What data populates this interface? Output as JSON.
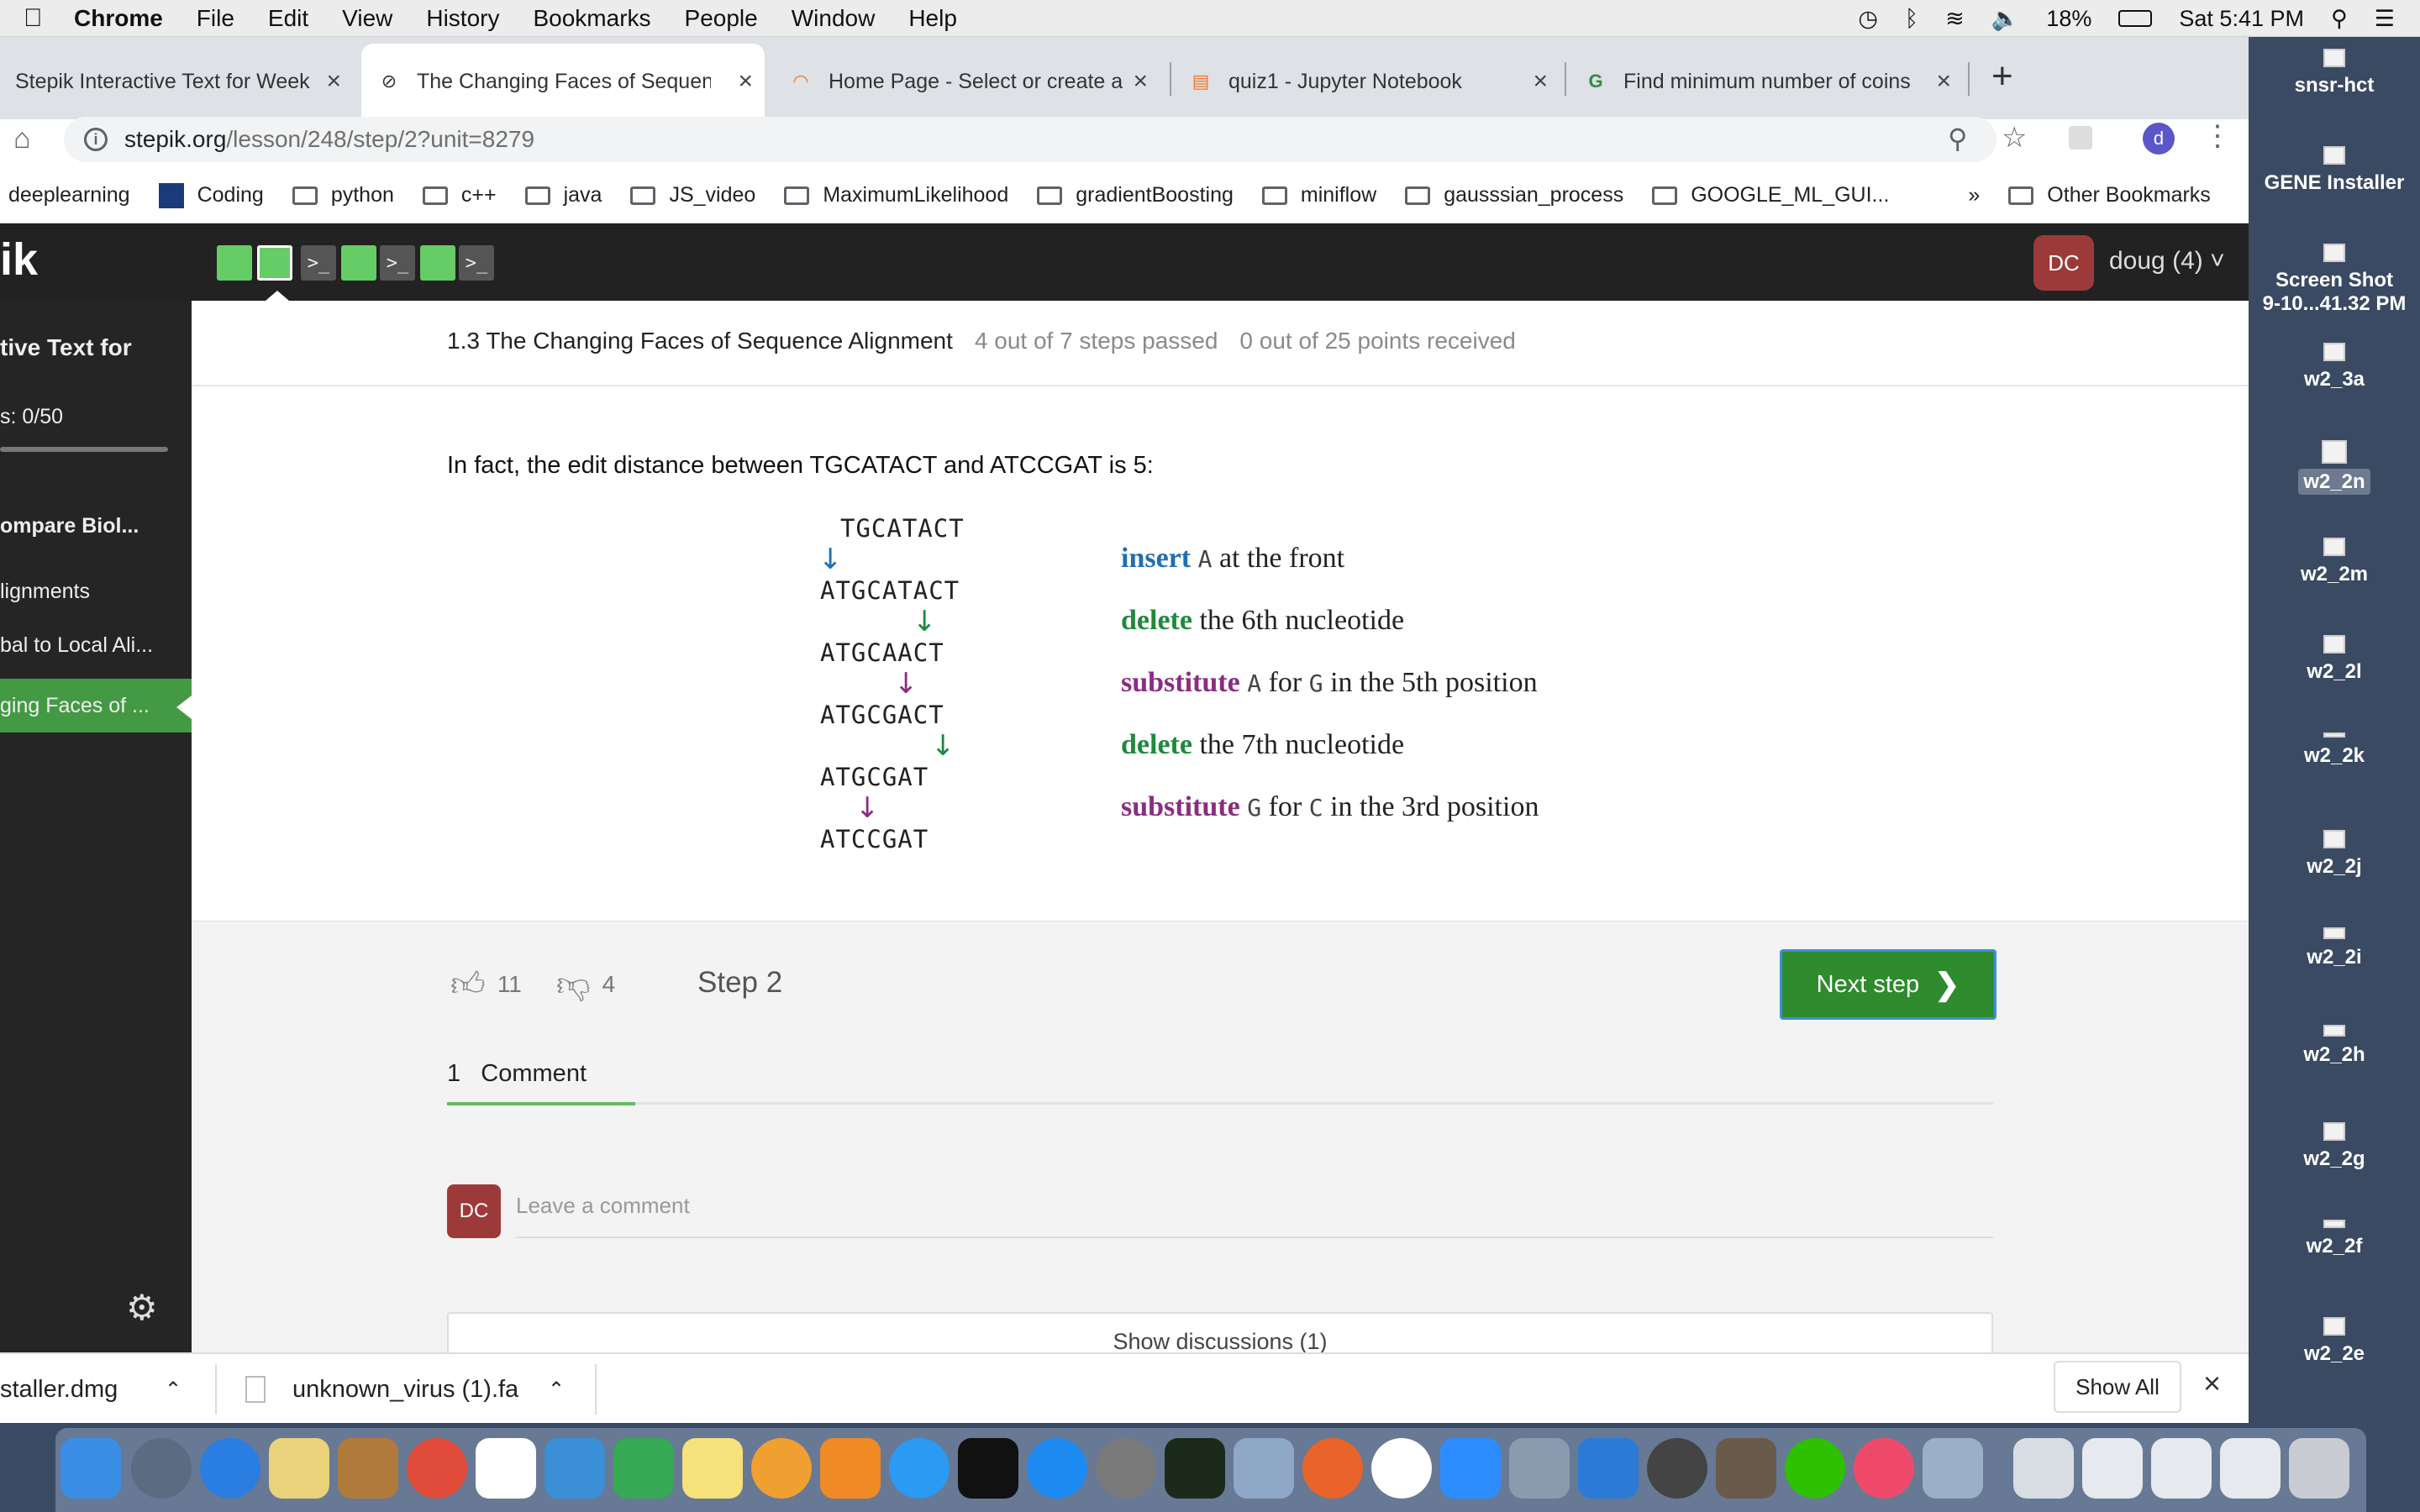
{
  "menubar": {
    "items": [
      "Chrome",
      "File",
      "Edit",
      "View",
      "History",
      "Bookmarks",
      "People",
      "Window",
      "Help"
    ],
    "battery": "18%",
    "clock": "Sat 5:41 PM"
  },
  "tabs": [
    {
      "title": "Stepik Interactive Text for Week"
    },
    {
      "title": "The Changing Faces of Sequence"
    },
    {
      "title": "Home Page - Select or create a"
    },
    {
      "title": "quiz1 - Jupyter Notebook"
    },
    {
      "title": "Find minimum number of coins"
    }
  ],
  "address": {
    "domain": "stepik.org",
    "path": "/lesson/248/step/2?unit=8279"
  },
  "profile_initial": "d",
  "bookmarks": [
    "deeplearning",
    "Coding",
    "python",
    "c++",
    "java",
    "JS_video",
    "MaximumLikelihood",
    "gradientBoosting",
    "miniflow",
    "gausssian_process",
    "GOOGLE_ML_GUI...",
    "»",
    "Other Bookmarks"
  ],
  "stepik": {
    "logo": "ik",
    "user_initials": "DC",
    "user_name": "doug (4) ˅",
    "sidebar": {
      "course_title": "tive Text for",
      "progress": "s:  0/50",
      "items": [
        "ompare Biol...",
        "lignments",
        "bal to Local Ali...",
        "ging Faces of ..."
      ]
    },
    "breadcrumb": {
      "lesson": "1.3 The Changing Faces of Sequence Alignment",
      "steps": "4 out of 7 steps passed",
      "points": "0 out of 25 points  received"
    },
    "intro": "In fact, the edit distance between TGCATACT and ATCCGAT is 5:",
    "sequences": [
      "TGCATACT",
      "ATGCATACT",
      "ATGCAACT",
      "ATGCGACT",
      "ATGCGAT",
      "ATCCGAT"
    ],
    "operations": [
      {
        "kw": "insert",
        "a": "A",
        "rest": "at the front"
      },
      {
        "kw": "delete",
        "rest": "the 6th nucleotide"
      },
      {
        "kw": "substitute",
        "a": "A",
        "mid": "for",
        "b": "G",
        "rest": "in the 5th position"
      },
      {
        "kw": "delete",
        "rest": "the 7th nucleotide"
      },
      {
        "kw": "substitute",
        "a": "G",
        "mid": "for",
        "b": "C",
        "rest": "in the 3rd position"
      }
    ],
    "likes": "11",
    "dislikes": "4",
    "step_label": "Step 2",
    "next_button": "Next step",
    "comments_tab": "1   Comment",
    "comment_avatar": "DC",
    "comment_placeholder": "Leave a comment",
    "show_discussions": "Show discussions (1)"
  },
  "downloads": [
    {
      "name": "staller.dmg"
    },
    {
      "name": "unknown_virus (1).fa"
    }
  ],
  "show_all": "Show All",
  "desktop_icons": [
    "snsr-hct",
    "GENE Installer",
    "Screen Shot",
    "9-10...41.32 PM",
    "w2_3a",
    "w2_2n",
    "w2_2m",
    "w2_2l",
    "w2_2k",
    "w2_2j",
    "w2_2i",
    "w2_2h",
    "w2_2g",
    "w2_2f",
    "w2_2e"
  ]
}
